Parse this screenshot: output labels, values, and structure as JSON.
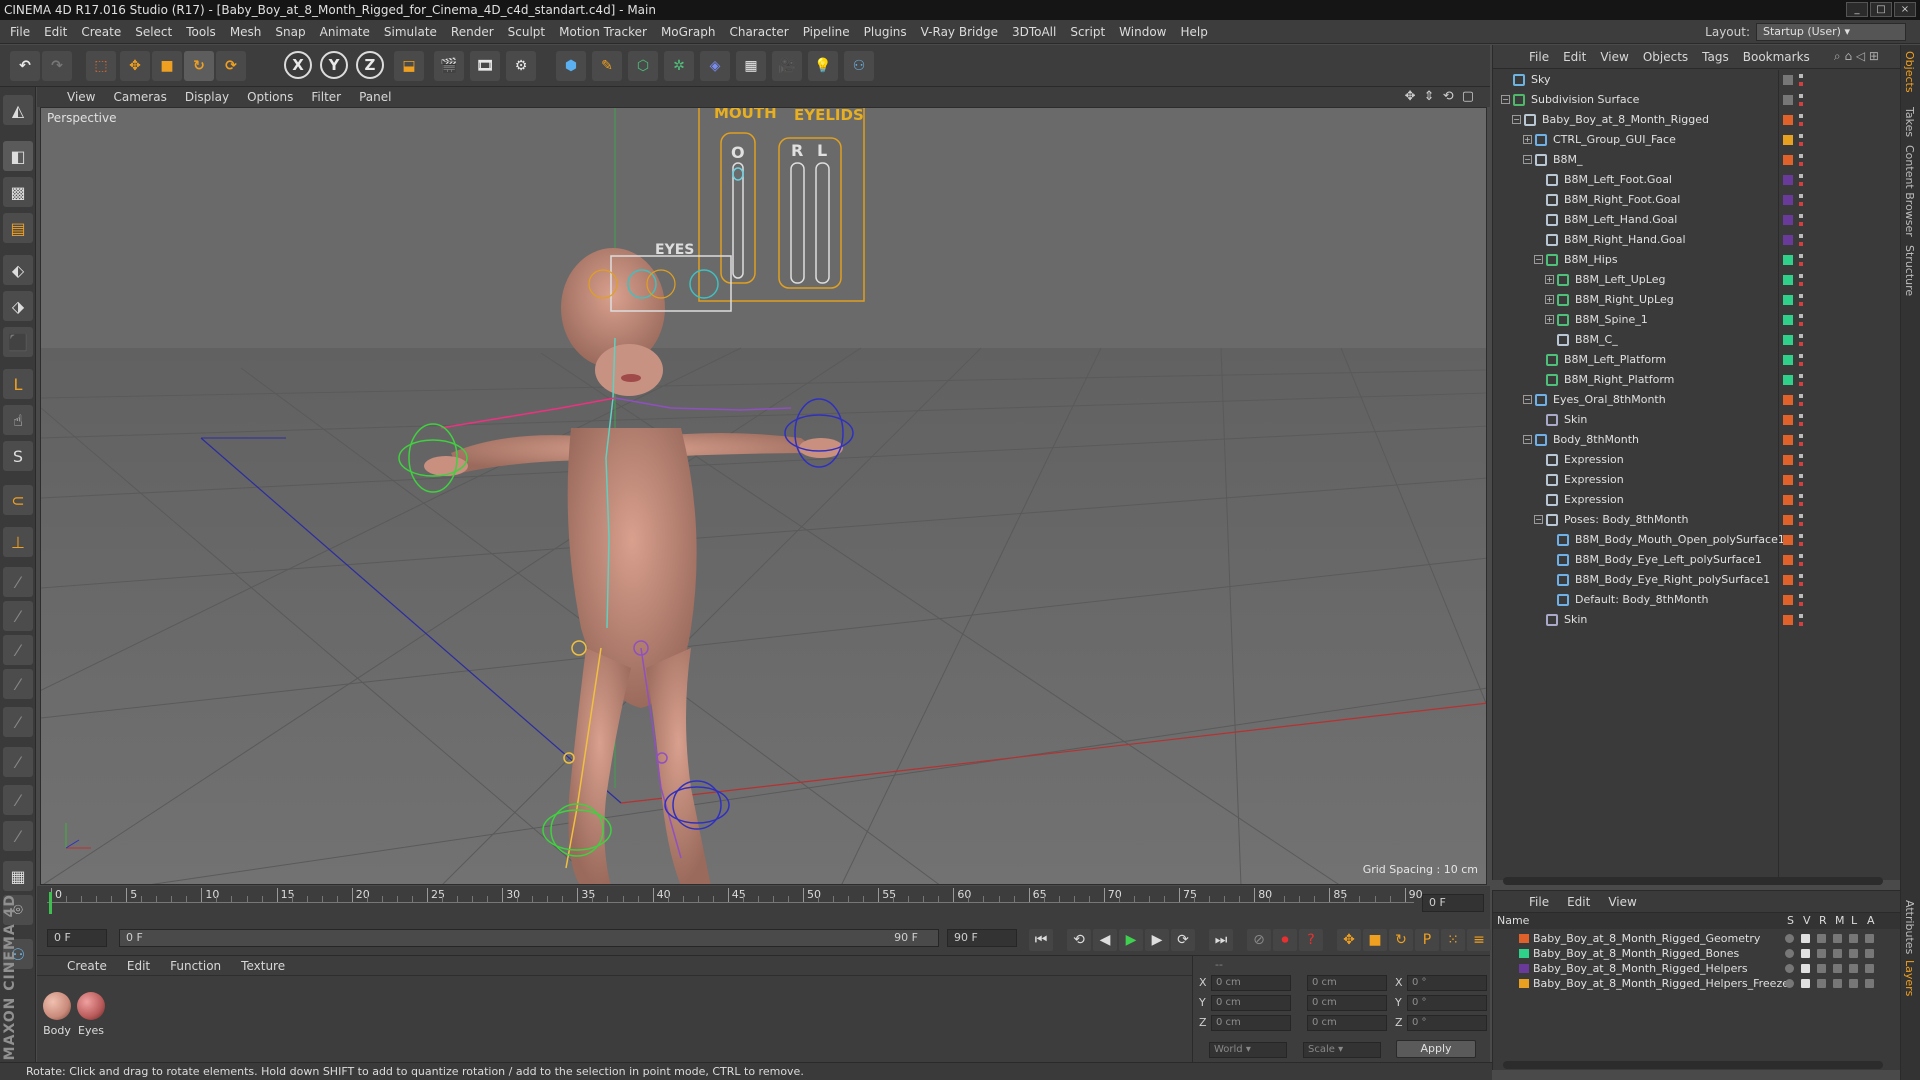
{
  "window": {
    "title": "CINEMA 4D R17.016 Studio (R17) - [Baby_Boy_at_8_Month_Rigged_for_Cinema_4D_c4d_standart.c4d] - Main"
  },
  "menubar": {
    "items": [
      "File",
      "Edit",
      "Create",
      "Select",
      "Tools",
      "Mesh",
      "Snap",
      "Animate",
      "Simulate",
      "Render",
      "Sculpt",
      "Motion Tracker",
      "MoGraph",
      "Character",
      "Pipeline",
      "Plugins",
      "V-Ray Bridge",
      "3DToAll",
      "Script",
      "Window",
      "Help"
    ],
    "layout_label": "Layout:",
    "layout_value": "Startup (User)"
  },
  "toolbar": {
    "axis_x": "X",
    "axis_y": "Y",
    "axis_z": "Z"
  },
  "viewport_menu": [
    "View",
    "Cameras",
    "Display",
    "Options",
    "Filter",
    "Panel"
  ],
  "viewport": {
    "label": "Perspective",
    "grid_spacing": "Grid Spacing : 10 cm",
    "gui_mouth": "MOUTH",
    "gui_eyelids": "EYELIDS",
    "gui_o": "O",
    "gui_r": "R",
    "gui_l": "L",
    "gui_eyes": "EYES"
  },
  "timeline": {
    "ticks": [
      "0",
      "5",
      "10",
      "15",
      "20",
      "25",
      "30",
      "35",
      "40",
      "45",
      "50",
      "55",
      "60",
      "65",
      "70",
      "75",
      "80",
      "85",
      "90"
    ],
    "current_frame": "0 F"
  },
  "playback": {
    "start_frame": "0 F",
    "range_start": "0 F",
    "range_end": "90 F",
    "end_frame": "90 F"
  },
  "material_manager": {
    "menu": [
      "Create",
      "Edit",
      "Function",
      "Texture"
    ],
    "materials": [
      {
        "name": "Body",
        "color": "#c98a7a"
      },
      {
        "name": "Eyes",
        "color": "#b85a5a"
      }
    ]
  },
  "coordinates": {
    "header": "--",
    "rows": [
      {
        "axis": "X",
        "pos": "0 cm",
        "size": "0 cm",
        "rot_axis": "X",
        "rot": "0 °"
      },
      {
        "axis": "Y",
        "pos": "0 cm",
        "size": "0 cm",
        "rot_axis": "Y",
        "rot": "0 °"
      },
      {
        "axis": "Z",
        "pos": "0 cm",
        "size": "0 cm",
        "rot_axis": "Z",
        "rot": "0 °"
      }
    ],
    "mode_world": "World",
    "mode_scale": "Scale",
    "apply": "Apply"
  },
  "status_bar": {
    "text": "Rotate: Click and drag to rotate elements. Hold down SHIFT to add to quantize rotation / add to the selection in point mode, CTRL to remove."
  },
  "object_manager": {
    "menu": [
      "File",
      "Edit",
      "View",
      "Objects",
      "Tags",
      "Bookmarks"
    ],
    "objects": [
      {
        "name": "Sky",
        "depth": 0,
        "expander": "",
        "icon": "#6db5e0",
        "tag": "#777777"
      },
      {
        "name": "Subdivision Surface",
        "depth": 0,
        "expander": "−",
        "icon": "#4fb86a",
        "tag": "#777777"
      },
      {
        "name": "Baby_Boy_at_8_Month_Rigged",
        "depth": 1,
        "expander": "−",
        "icon": "#b9c7d4",
        "tag": "#e0622a"
      },
      {
        "name": "CTRL_Group_GUI_Face",
        "depth": 2,
        "expander": "+",
        "icon": "#6fb0e6",
        "tag": "#e8a020"
      },
      {
        "name": "B8M_",
        "depth": 2,
        "expander": "−",
        "icon": "#b9c7d4",
        "tag": "#e0622a"
      },
      {
        "name": "B8M_Left_Foot.Goal",
        "depth": 3,
        "expander": "",
        "icon": "#b9c7d4",
        "tag": "#6a3a9a"
      },
      {
        "name": "B8M_Right_Foot.Goal",
        "depth": 3,
        "expander": "",
        "icon": "#b9c7d4",
        "tag": "#6a3a9a"
      },
      {
        "name": "B8M_Left_Hand.Goal",
        "depth": 3,
        "expander": "",
        "icon": "#b9c7d4",
        "tag": "#6a3a9a"
      },
      {
        "name": "B8M_Right_Hand.Goal",
        "depth": 3,
        "expander": "",
        "icon": "#b9c7d4",
        "tag": "#6a3a9a"
      },
      {
        "name": "B8M_Hips",
        "depth": 3,
        "expander": "−",
        "icon": "#4fc07a",
        "tag": "#2fd08a"
      },
      {
        "name": "B8M_Left_UpLeg",
        "depth": 4,
        "expander": "+",
        "icon": "#4fc07a",
        "tag": "#2fd08a"
      },
      {
        "name": "B8M_Right_UpLeg",
        "depth": 4,
        "expander": "+",
        "icon": "#4fc07a",
        "tag": "#2fd08a"
      },
      {
        "name": "B8M_Spine_1",
        "depth": 4,
        "expander": "+",
        "icon": "#4fc07a",
        "tag": "#2fd08a"
      },
      {
        "name": "B8M_C_",
        "depth": 4,
        "expander": "",
        "icon": "#b9c7d4",
        "tag": "#2fd08a"
      },
      {
        "name": "B8M_Left_Platform",
        "depth": 3,
        "expander": "",
        "icon": "#4fc07a",
        "tag": "#2fd08a"
      },
      {
        "name": "B8M_Right_Platform",
        "depth": 3,
        "expander": "",
        "icon": "#4fc07a",
        "tag": "#2fd08a"
      },
      {
        "name": "Eyes_Oral_8thMonth",
        "depth": 2,
        "expander": "−",
        "icon": "#6fb0e6",
        "tag": "#e0622a"
      },
      {
        "name": "Skin",
        "depth": 3,
        "expander": "",
        "icon": "#a9a9c9",
        "tag": "#e0622a"
      },
      {
        "name": "Body_8thMonth",
        "depth": 2,
        "expander": "−",
        "icon": "#6fb0e6",
        "tag": "#e0622a"
      },
      {
        "name": "Expression",
        "depth": 3,
        "expander": "",
        "icon": "#b9c7d4",
        "tag": "#e0622a"
      },
      {
        "name": "Expression",
        "depth": 3,
        "expander": "",
        "icon": "#b9c7d4",
        "tag": "#e0622a"
      },
      {
        "name": "Expression",
        "depth": 3,
        "expander": "",
        "icon": "#b9c7d4",
        "tag": "#e0622a"
      },
      {
        "name": "Poses: Body_8thMonth",
        "depth": 3,
        "expander": "−",
        "icon": "#b9c7d4",
        "tag": "#e0622a"
      },
      {
        "name": "B8M_Body_Mouth_Open_polySurface1",
        "depth": 4,
        "expander": "",
        "icon": "#6fb0e6",
        "tag": "#e0622a"
      },
      {
        "name": "B8M_Body_Eye_Left_polySurface1",
        "depth": 4,
        "expander": "",
        "icon": "#6fb0e6",
        "tag": "#e0622a"
      },
      {
        "name": "B8M_Body_Eye_Right_polySurface1",
        "depth": 4,
        "expander": "",
        "icon": "#6fb0e6",
        "tag": "#e0622a"
      },
      {
        "name": "Default: Body_8thMonth",
        "depth": 4,
        "expander": "",
        "icon": "#6fb0e6",
        "tag": "#e0622a"
      },
      {
        "name": "Skin",
        "depth": 3,
        "expander": "",
        "icon": "#a9a9c9",
        "tag": "#e0622a"
      }
    ]
  },
  "layer_manager": {
    "menu": [
      "File",
      "Edit",
      "View"
    ],
    "columns": {
      "name": "Name",
      "s": "S",
      "v": "V",
      "r": "R",
      "m": "M",
      "l": "L",
      "a": "A"
    },
    "layers": [
      {
        "name": "Baby_Boy_at_8_Month_Rigged_Geometry",
        "color": "#e0622a"
      },
      {
        "name": "Baby_Boy_at_8_Month_Rigged_Bones",
        "color": "#2fd08a"
      },
      {
        "name": "Baby_Boy_at_8_Month_Rigged_Helpers",
        "color": "#6a3a9a"
      },
      {
        "name": "Baby_Boy_at_8_Month_Rigged_Helpers_Freeze",
        "color": "#e8a020"
      }
    ]
  },
  "side_tabs": [
    "Objects",
    "Takes",
    "Content Browser",
    "Structure",
    "Attributes",
    "Layers"
  ]
}
